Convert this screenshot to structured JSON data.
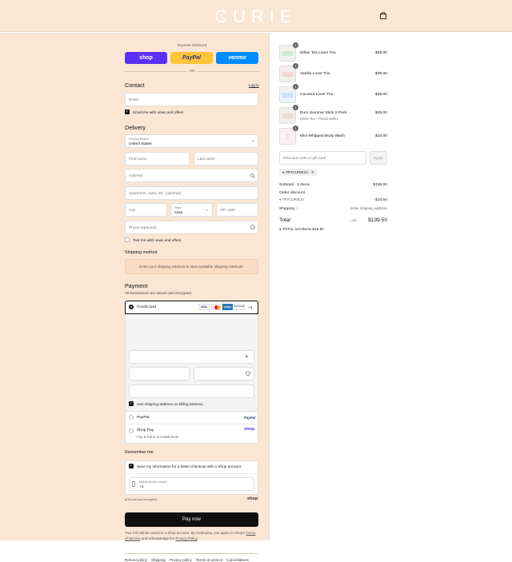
{
  "header": {
    "logo": "CURIE",
    "cart_icon": "shopping-bag-icon"
  },
  "express": {
    "title": "Express checkout",
    "buttons": [
      {
        "label": "shop",
        "color": "#5a31f4"
      },
      {
        "label": "PayPal",
        "color": "#ffc439"
      },
      {
        "label": "venmo",
        "color": "#008cff"
      }
    ],
    "or": "OR"
  },
  "contact": {
    "heading": "Contact",
    "login": "Log in",
    "email_placeholder": "Email",
    "email_news_label": "Email me with news and offers"
  },
  "delivery": {
    "heading": "Delivery",
    "country_label": "Country/Region",
    "country_value": "United States",
    "first_name": "First name",
    "last_name": "Last name",
    "address": "Address",
    "apartment": "Apartment, suite, etc. (optional)",
    "city": "City",
    "state_label": "State",
    "state_value": "Iowa",
    "zip": "ZIP code",
    "phone": "Phone (optional)",
    "text_news_label": "Text me with news and offers"
  },
  "shipping": {
    "heading": "Shipping method",
    "info": "Enter your shipping address to view available shipping methods."
  },
  "payment": {
    "heading": "Payment",
    "subtitle": "All transactions are secure and encrypted.",
    "credit_card": "Credit card",
    "card_logos": [
      "VISA",
      "MC",
      "AMEX",
      "DISCOVER"
    ],
    "more_cards": "+3",
    "billing_label": "Use shipping address as billing address",
    "paypal": "PayPal",
    "paypal_logo": "PayPal",
    "shop_pay": "Shop Pay",
    "shop_pay_sub": "Pay in full or in installments",
    "shop_logo": "shop"
  },
  "remember": {
    "heading": "Remember me",
    "save_label": "Save my information for a faster checkout with a Shop account",
    "mobile_label": "Mobile phone number",
    "mobile_value": "+1",
    "secure": "Secure and encrypted",
    "shop_logo": "shop"
  },
  "pay_now": "Pay now",
  "terms": {
    "line1": "Your info will be saved to a Shop account. By continuing, you agree to Shop's",
    "tos": "Terms of Service",
    "and": "and acknowledge the",
    "privacy": "Privacy Policy",
    "end": "."
  },
  "footer_links": [
    "Refund policy",
    "Shipping",
    "Privacy policy",
    "Terms of service",
    "Cancellations"
  ],
  "cart": {
    "items": [
      {
        "qty": "1",
        "name": "White Tea Lover Trio",
        "variant": "",
        "price": "$39.00",
        "tint": "#cfe8d0"
      },
      {
        "qty": "1",
        "name": "Vanilla Lover Trio",
        "variant": "",
        "price": "$39.00",
        "tint": "#f1d7d2"
      },
      {
        "qty": "1",
        "name": "Coconut Lover Trio",
        "variant": "",
        "price": "$39.00",
        "tint": "#cfe0f2"
      },
      {
        "qty": "1",
        "name": "Euro Summer Stick 2-Pack",
        "variant": "White Tea + Peach Bellini",
        "price": "$28.00",
        "tint": "#e7ddd0"
      },
      {
        "qty": "1",
        "name": "Mini Whipped Body Wash",
        "variant": "",
        "price": "$10.00",
        "tint": "#f2e3e3"
      }
    ],
    "discount_placeholder": "Discount code or gift card",
    "apply": "Apply",
    "code_tag": "TRYCURIE10",
    "subtotal_label": "Subtotal · 5 items",
    "subtotal": "$155.00",
    "order_discount_label": "Order discount",
    "order_discount_code": "TRYCURIE10",
    "order_discount_value": "- $15.50",
    "shipping_label": "Shipping",
    "shipping_value": "Enter shipping address",
    "total_label": "Total",
    "currency": "USD",
    "total": "$139.50",
    "savings": "TOTAL SAVINGS $15.50"
  }
}
